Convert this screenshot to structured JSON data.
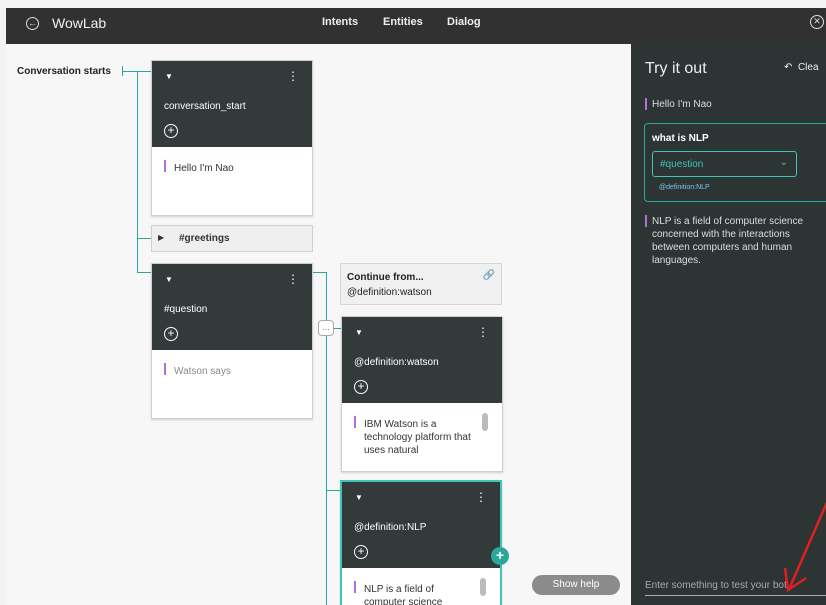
{
  "header": {
    "app_name": "WowLab",
    "tabs": [
      {
        "label": "Intents"
      },
      {
        "label": "Entities"
      },
      {
        "label": "Dialog"
      }
    ]
  },
  "canvas": {
    "conversation_label": "Conversation starts",
    "nodes": {
      "start": {
        "title": "conversation_start",
        "response": "Hello I'm Nao"
      },
      "greetings_folder": {
        "label": "#greetings"
      },
      "question": {
        "title": "#question",
        "response": "Watson says"
      },
      "jump": {
        "line1": "Continue from...",
        "line2": "@definition:watson"
      },
      "watson": {
        "title": "@definition:watson",
        "response": "IBM Watson is a technology platform that uses natural"
      },
      "nlp": {
        "title": "@definition:NLP",
        "response": "NLP is a field of computer science"
      }
    },
    "show_help": "Show help"
  },
  "panel": {
    "title": "Try it out",
    "clear_label": "Clea",
    "bot_greeting": "Hello I'm Nao",
    "user_message": "what is NLP",
    "intent_selected": "#question",
    "entity_tag": "@definition:NLP",
    "bot_reply": "NLP is a field of computer science concerned with the interactions between computers and human languages.",
    "input_placeholder": "Enter something to test your bot"
  },
  "colors": {
    "accent": "#2ba89b",
    "node_header": "#323a3a",
    "panel_bg": "#2c3434",
    "annotation_arrow": "#e02020"
  }
}
